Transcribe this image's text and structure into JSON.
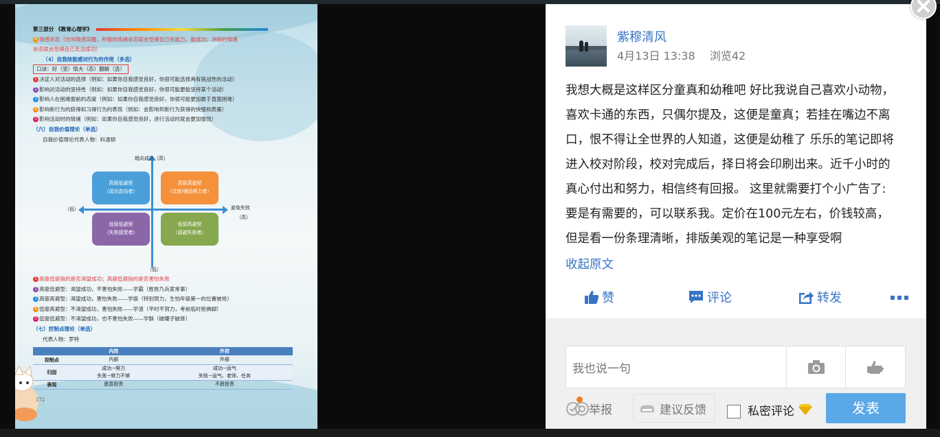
{
  "document": {
    "section_header": "第三部分 《教育心理学》",
    "line_emotion_a": "情感状态（也叫情感突醒，积极的情绪状态就会觉得自己有能力，能成功；消极的情绪",
    "line_emotion_b": "状态就会觉得自己无法成功）",
    "heading_4": "（4）自我效能感对行为的作用（多选）",
    "mnemonic": "口诀：好（坚）情大（态）翻解（选）",
    "effects": [
      {
        "num": "1",
        "text": "决定人对活动的选择（例如：如果你自我感觉良好，你很可能选择具有挑战性的活动）"
      },
      {
        "num": "2",
        "text": "影响对活动的坚持性（例如：如果你自我感觉良好，你很可能更能坚持某个活动）"
      },
      {
        "num": "3",
        "text": "影响人在困难面前的态度（例如：如果你自我感觉良好，你很可能更加敢于直面困难）"
      },
      {
        "num": "4",
        "text": "影响新行为的获得和习得行为的表现（例如：会影响到新行为获得的快慢和质量）"
      },
      {
        "num": "5",
        "text": "影响活动时的情绪（例如：如果你自我感觉良好，进行活动时就会更加愉悦）"
      }
    ],
    "heading_6": "（六）自我价值理论（单选）",
    "rep_6": "自我价值理论代表人物：科温顿",
    "quadrant": {
      "top_label": "趋向成功（高）",
      "left_label": "（低）",
      "right_label": "避免失败",
      "right_label_b": "（高）",
      "bottom_label": "（低）",
      "boxes": [
        {
          "line1": "高驱低避型",
          "line2": "（成功定向者）"
        },
        {
          "line1": "高驱高避型",
          "line2": "（过度/强迫努力者）"
        },
        {
          "line1": "低驱低避型",
          "line2": "（失败接受者）"
        },
        {
          "line1": "低驱高避型",
          "line2": "（逃避失败者）"
        }
      ]
    },
    "types": [
      {
        "num": "1",
        "text": "高驱低驱指的是否渴望成功；高避低避指的是否害怕失败"
      },
      {
        "num": "2",
        "text": "高驱低避型：渴望成功，不害怕失败——学霸（胜败乃兵家常事）"
      },
      {
        "num": "3",
        "text": "高驱高避型：渴望成功，害怕失败——学级（特别努力，生怕年级第一的位置被抢）"
      },
      {
        "num": "4",
        "text": "低驱高避型：不渴望成功，害怕失败——学渣（平时不努力，考前临时抱佛脚）"
      },
      {
        "num": "5",
        "text": "低驱低避型：不渴望成功，也不害怕失败——学酥（破罐子破摔）"
      }
    ],
    "heading_7": "（七）控制点理论（单选）",
    "rep_7": "代表人物：罗特",
    "table": {
      "headers": [
        "",
        "内控",
        "外控"
      ],
      "rows": [
        {
          "label": "控制点",
          "c1": "内部",
          "c2": "外部"
        },
        {
          "label": "归因",
          "c1": "成功→努力",
          "c1b": "失败→努力不够",
          "c2": "成功→运气",
          "c2b": "失败→运气、老师、任务"
        },
        {
          "label": "表现",
          "c1": "愿意担责",
          "c2": "不愿担责"
        }
      ]
    },
    "page_number": "172"
  },
  "post": {
    "username": "紫穆清风",
    "date": "4月13日 13:38",
    "views": "浏览42",
    "content_lines": [
      "我想大概是这样区分童真和幼稚吧 好比我说自己喜欢小动物，",
      "喜欢卡通的东西，只偶尔提及，这便是童真；若挂在嘴边不离",
      "口，恨不得让全世界的人知道，这便是幼稚了 乐乐的笔记即将",
      "进入校对阶段，校对完成后，择日将会印刷出来。近千小时的",
      "真心付出和努力，相信终有回报。 这里就需要打个小广告了:",
      "要是有需要的，可以联系我。定价在100元左右，价钱较高，",
      "但是看一份条理清晰，排版美观的笔记是一种享受啊"
    ],
    "collapse_label": "收起原文",
    "like_label": "赞",
    "comment_label": "评论",
    "share_label": "转发"
  },
  "comment_box": {
    "placeholder": "我也说一句",
    "report_label": "举报",
    "feedback_label": "建议反馈",
    "private_label": "私密评论",
    "private_checked": false,
    "submit_label": "发表"
  },
  "colors": {
    "link_blue": "#3874c5",
    "submit_blue": "#5aa8e8",
    "gold_gem": "#f5c518",
    "notify_orange": "#f07c1b"
  },
  "icons": [
    "thumb-up-icon",
    "comment-icon",
    "share-icon",
    "more-icon",
    "camera-icon",
    "hand-icon",
    "report-icon",
    "feedback-icon",
    "diamond-icon",
    "close-icon"
  ]
}
